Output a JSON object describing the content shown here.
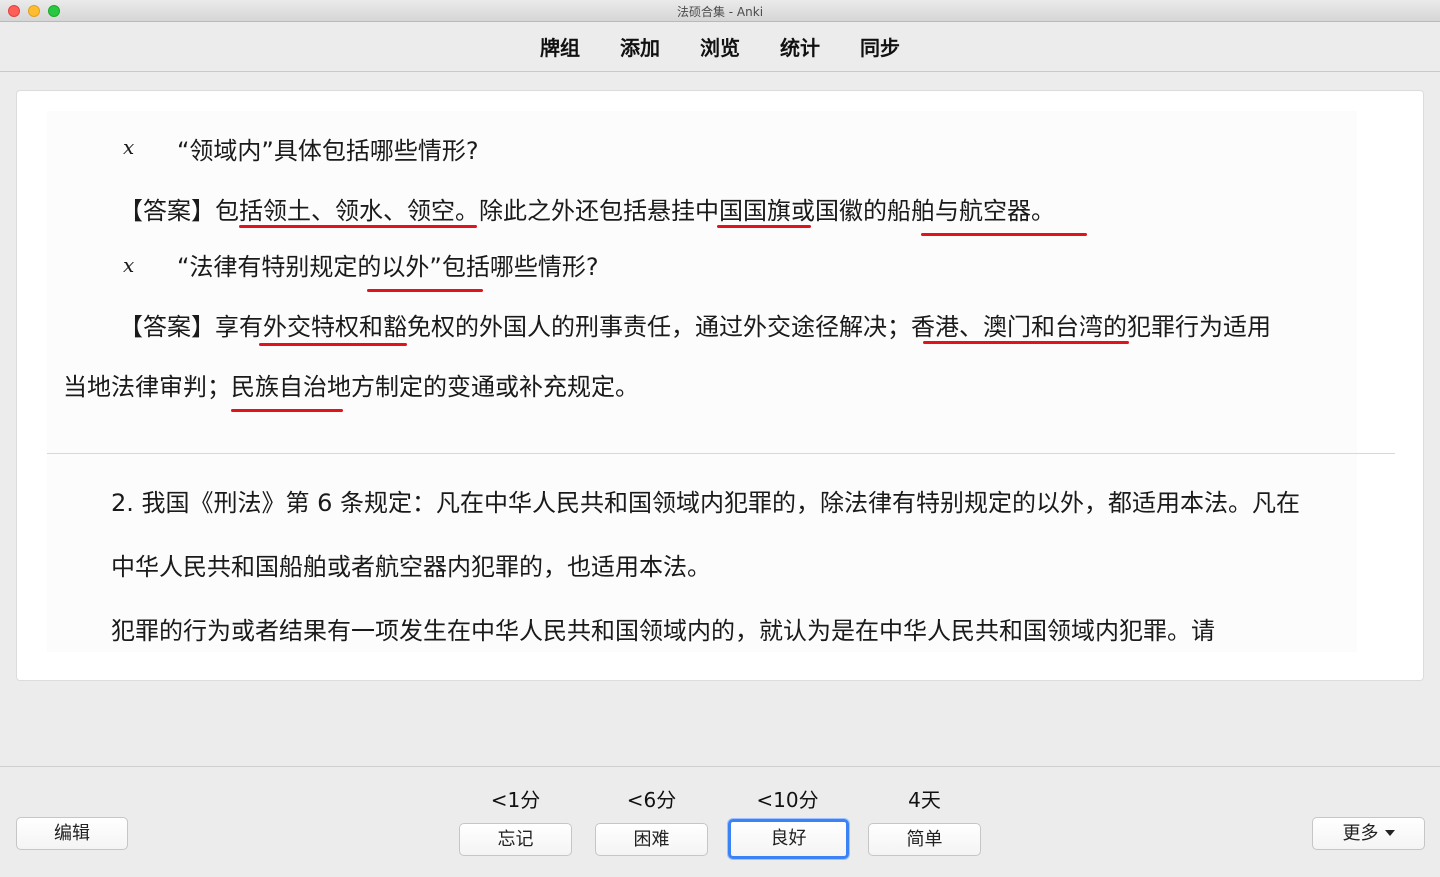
{
  "window": {
    "title": "法硕合集 - Anki"
  },
  "toolbar": {
    "items": [
      {
        "label": "牌组"
      },
      {
        "label": "添加"
      },
      {
        "label": "浏览"
      },
      {
        "label": "统计"
      },
      {
        "label": "同步"
      }
    ]
  },
  "card": {
    "q1": "“领域内”具体包括哪些情形?",
    "a1": "【答案】包括领土、领水、领空。除此之外还包括悬挂中国国旗或国徽的船舶与航空器。",
    "q2": "“法律有特别规定的以外”包括哪些情形?",
    "a2_line1": "【答案】享有外交特权和豁免权的外国人的刑事责任，通过外交途径解决；香港、澳门和台湾的犯罪行为适用",
    "a2_line2": "当地法律审判；民族自治地方制定的变通或补充规定。",
    "marks": {
      "q1": "x",
      "q2": "x"
    },
    "p2_line1": "2.  我国《刑法》第 6 条规定：凡在中华人民共和国领域内犯罪的，除法律有特别规定的以外，都适用本法。凡在",
    "p2_line2": "中华人民共和国船舶或者航空器内犯罪的，也适用本法。",
    "p2_line3": "犯罪的行为或者结果有一项发生在中华人民共和国领域内的，就认为是在中华人民共和国领域内犯罪。请",
    "underline_color": "#e0141c"
  },
  "bottom": {
    "edit_label": "编辑",
    "more_label": "更多",
    "answers": [
      {
        "interval": "<1分",
        "label": "忘记"
      },
      {
        "interval": "<6分",
        "label": "困难"
      },
      {
        "interval": "<10分",
        "label": "良好"
      },
      {
        "interval": "4天",
        "label": "简单"
      }
    ]
  }
}
